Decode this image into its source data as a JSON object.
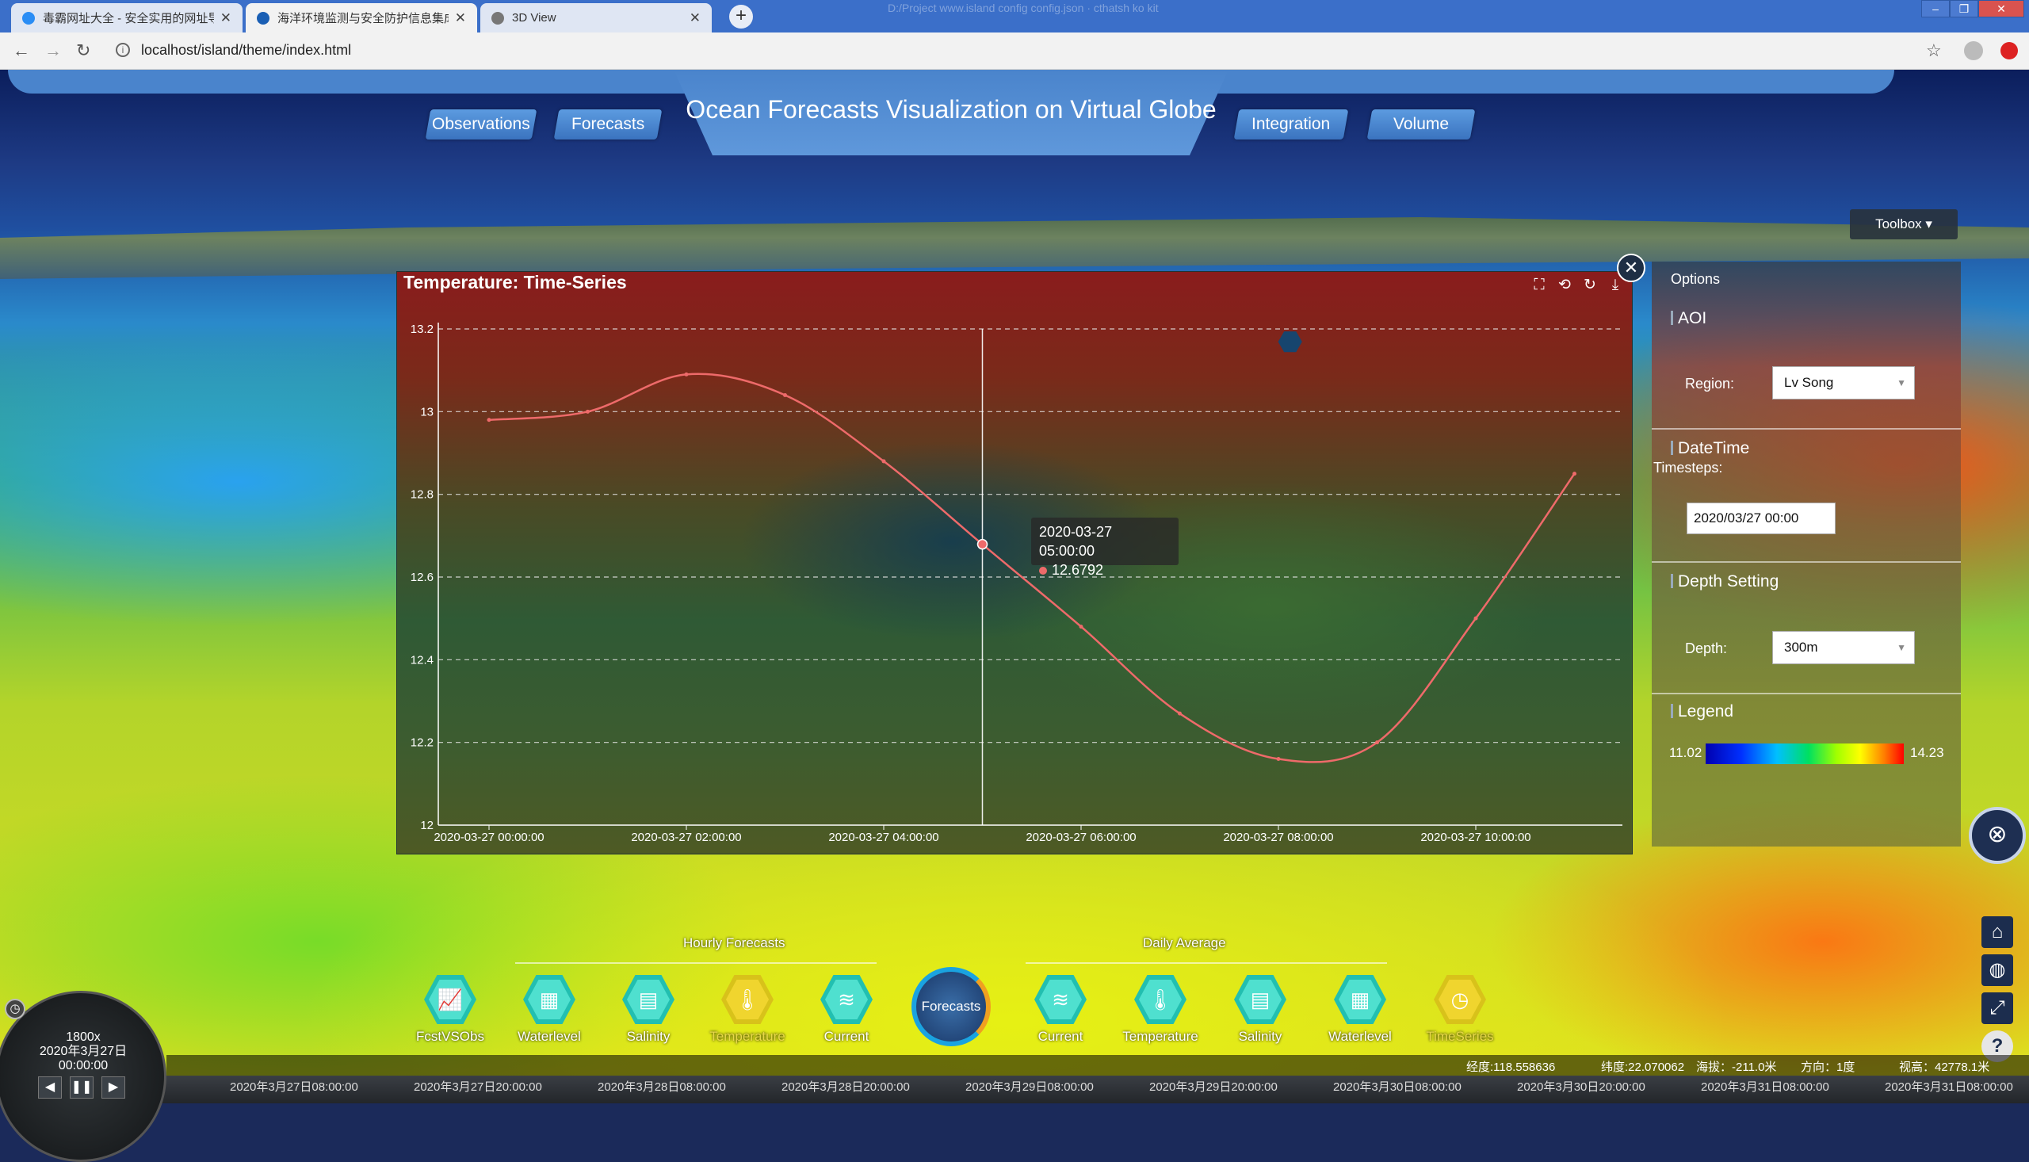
{
  "browser": {
    "tabs": [
      {
        "title": "毒霸网址大全 - 安全实用的网址导",
        "icon_color": "#2a8df5",
        "active": false
      },
      {
        "title": "海洋环境监测与安全防护信息集成",
        "icon_color": "#1a5fb4",
        "active": true
      },
      {
        "title": "3D View",
        "icon_color": "#777777",
        "active": false
      }
    ],
    "new_tab": "+",
    "window_title_ghost": "D:/Project www.island config config.json · cthatsh ko kit",
    "url": "localhost/island/theme/index.html"
  },
  "app": {
    "title": "Ocean Forecasts Visualization on Virtual Globe",
    "nav": [
      "Observations",
      "Forecasts",
      "Integration",
      "Volume"
    ]
  },
  "toolbox": {
    "label": "Toolbox ▾",
    "icon": "gear-cluster-icon"
  },
  "chart_panel": {
    "title": "Temperature: Time-Series",
    "tools": [
      "zoom-icon",
      "zoom-reset-icon",
      "restore-icon",
      "save-icon"
    ],
    "tooltip": {
      "time": "2020-03-27 05:00:00",
      "value": "12.6792"
    }
  },
  "chart_data": {
    "type": "line",
    "title": "Temperature: Time-Series",
    "x": [
      "2020-03-27 00:00:00",
      "2020-03-27 01:00:00",
      "2020-03-27 02:00:00",
      "2020-03-27 03:00:00",
      "2020-03-27 04:00:00",
      "2020-03-27 05:00:00",
      "2020-03-27 06:00:00",
      "2020-03-27 07:00:00",
      "2020-03-27 08:00:00",
      "2020-03-27 09:00:00",
      "2020-03-27 10:00:00",
      "2020-03-27 11:00:00"
    ],
    "x_tick_labels": [
      "2020-03-27 00:00:00",
      "2020-03-27 02:00:00",
      "2020-03-27 04:00:00",
      "2020-03-27 06:00:00",
      "2020-03-27 08:00:00",
      "2020-03-27 10:00:00"
    ],
    "series": [
      {
        "values": [
          12.98,
          13.0,
          13.09,
          13.04,
          12.88,
          12.6792,
          12.48,
          12.27,
          12.16,
          12.2,
          12.5,
          12.85
        ],
        "color": "#ee6a6a"
      }
    ],
    "yticks": [
      12,
      12.2,
      12.4,
      12.6,
      12.8,
      13,
      13.2
    ],
    "ytick_labels": [
      "12",
      "12.2",
      "12.4",
      "12.6",
      "12.8",
      "13",
      "13.2"
    ],
    "ylim": [
      12,
      13.2
    ],
    "grid": true,
    "highlight_index": 5
  },
  "options": {
    "title": "Options",
    "aoi": {
      "heading": "AOI",
      "region_label": "Region:",
      "region_value": "Lv Song"
    },
    "datetime": {
      "heading": "DateTime",
      "timesteps_label": "Timesteps:",
      "timesteps_value": "2020/03/27 00:00"
    },
    "depth": {
      "heading": "Depth Setting",
      "depth_label": "Depth:",
      "depth_value": "300m"
    },
    "legend": {
      "heading": "Legend",
      "min": "11.02",
      "max": "14.23"
    }
  },
  "dock": {
    "hourly_label": "Hourly Forecasts",
    "daily_label": "Daily Average",
    "center_label": "Forecasts",
    "hourly_items": [
      {
        "label": "FcstVSObs",
        "icon": "chart-icon",
        "glyph": "📈",
        "dim": false
      },
      {
        "label": "Waterlevel",
        "icon": "waterlevel-icon",
        "glyph": "▦",
        "dim": false
      },
      {
        "label": "Salinity",
        "icon": "salinity-icon",
        "glyph": "▤",
        "dim": false
      },
      {
        "label": "Temperature",
        "icon": "thermometer-icon",
        "glyph": "🌡",
        "dim": true
      },
      {
        "label": "Current",
        "icon": "waves-icon",
        "glyph": "≋",
        "dim": false
      }
    ],
    "daily_items": [
      {
        "label": "Current",
        "icon": "waves-icon",
        "glyph": "≋",
        "dim": false
      },
      {
        "label": "Temperature",
        "icon": "thermometer-icon",
        "glyph": "🌡",
        "dim": false
      },
      {
        "label": "Salinity",
        "icon": "salinity-icon",
        "glyph": "▤",
        "dim": false
      },
      {
        "label": "Waterlevel",
        "icon": "waterlevel-icon",
        "glyph": "▦",
        "dim": false
      },
      {
        "label": "TimeSeries",
        "icon": "timeseries-icon",
        "glyph": "◷",
        "dim": true
      }
    ]
  },
  "status": {
    "lon": "经度:118.558636",
    "lat": "纬度:22.070062",
    "alt": "海拔：-211.0米",
    "heading": "方向：1度",
    "view": "视高：42778.1米"
  },
  "clock": {
    "speed": "1800x",
    "date": "2020年3月27日",
    "time": "00:00:00"
  },
  "timeline_ticks": [
    "2020年3月27日08:00:00",
    "2020年3月27日20:00:00",
    "2020年3月28日08:00:00",
    "2020年3月28日20:00:00",
    "2020年3月29日08:00:00",
    "2020年3月29日20:00:00",
    "2020年3月30日08:00:00",
    "2020年3月30日20:00:00",
    "2020年3月31日08:00:00",
    "2020年3月31日08:00:00"
  ]
}
